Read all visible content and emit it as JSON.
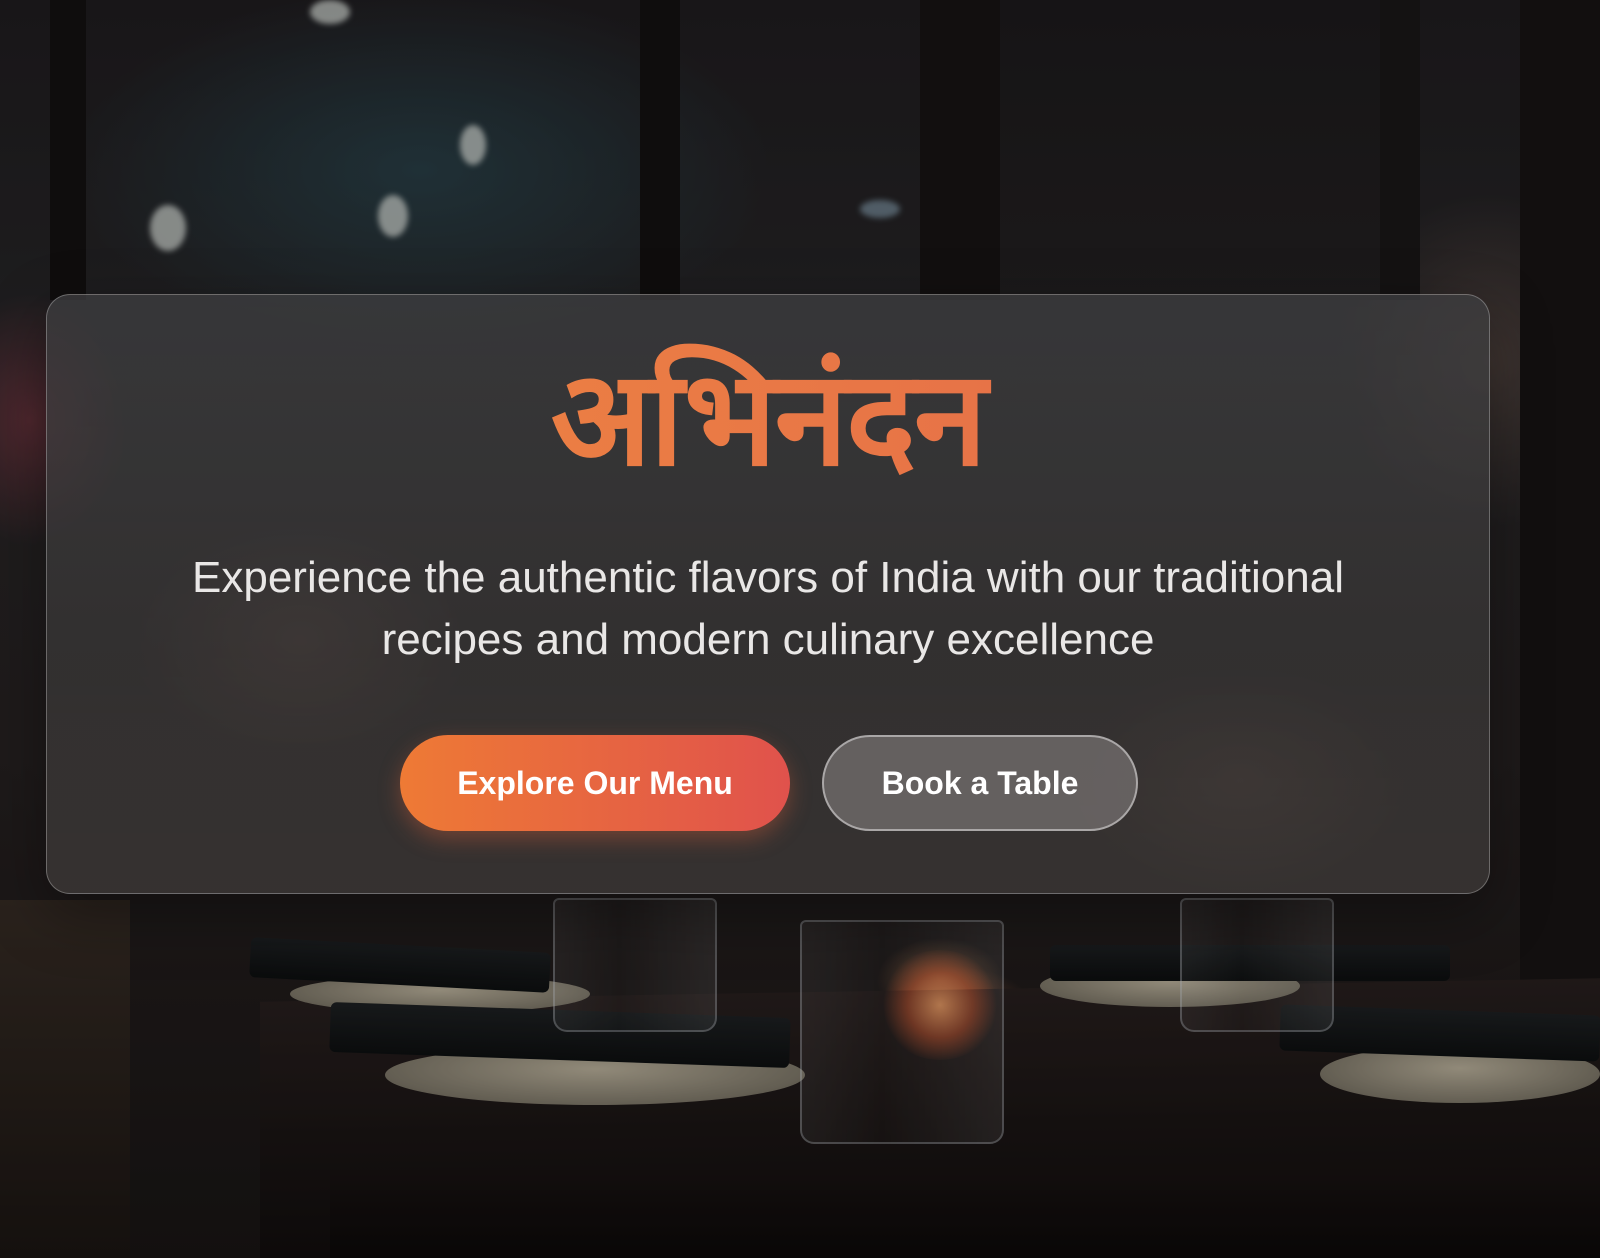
{
  "hero": {
    "title": "अभिनंदन",
    "subtitle": "Experience the authentic flavors of India with our traditional recipes and modern culinary excellence",
    "primary_button": "Explore Our Menu",
    "secondary_button": "Book a Table"
  },
  "colors": {
    "accent_start": "#f08a40",
    "accent_end": "#e2674b",
    "text_light": "#e9e7e6",
    "card_bg": "rgba(62,62,64,0.75)"
  }
}
